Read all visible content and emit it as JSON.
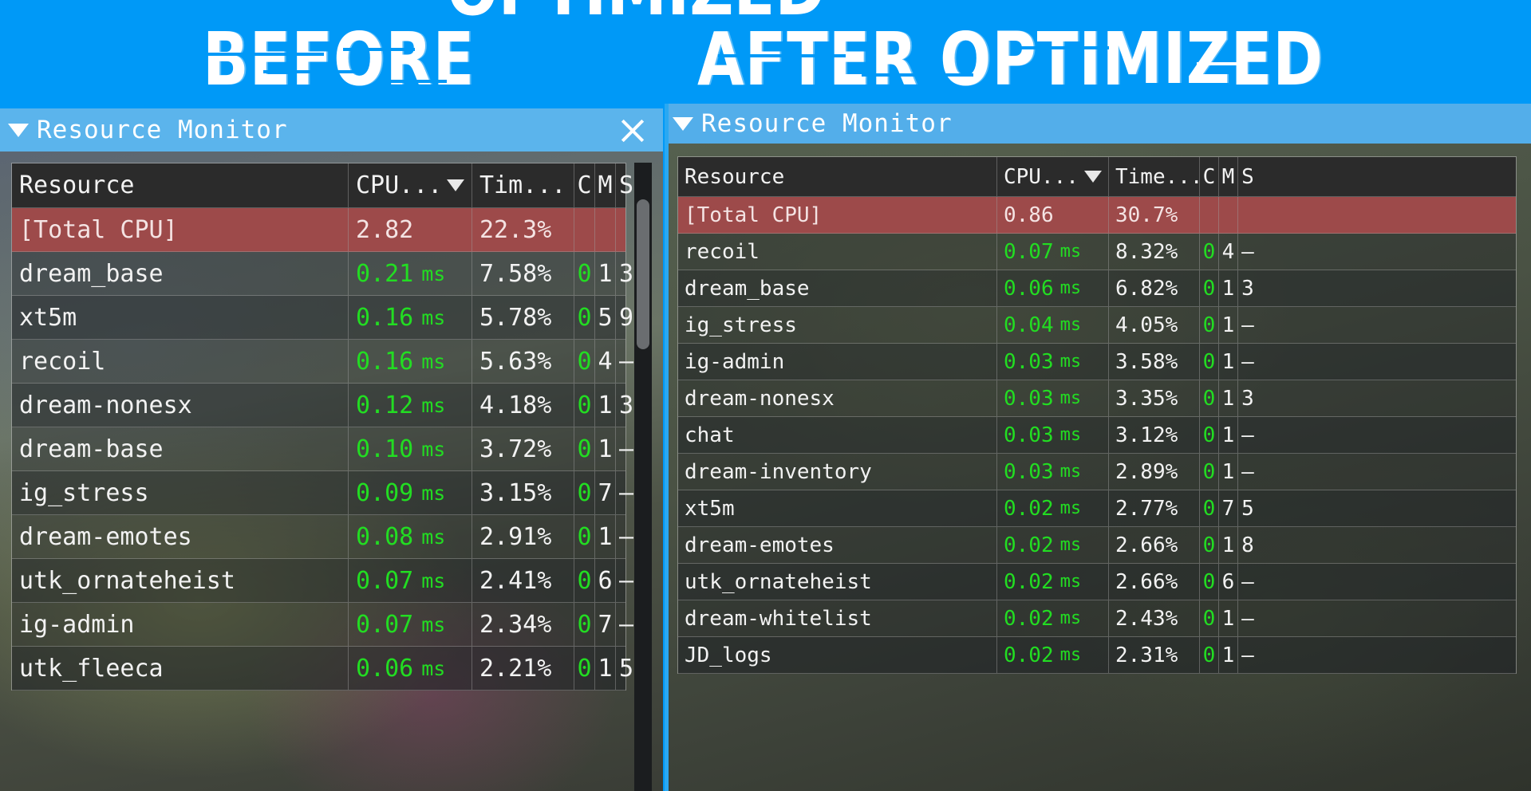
{
  "banner": {
    "before_label": "BEFORE",
    "after_label": "AFTER OPTIMIZED",
    "top_remnant": "OPTIMIZED",
    "background_color": "#0099f7"
  },
  "colors": {
    "banner_blue": "#0099f7",
    "titlebar_blue": "#5bb4ec",
    "total_row_red": "#9d4a4a",
    "value_green": "#22dd22",
    "header_dark": "#2b2b2b",
    "accent_outline": "#2aa8f2"
  },
  "left_window": {
    "title": "Resource Monitor",
    "collapse_icon": "triangle-down-icon",
    "close_icon": "close-icon",
    "columns": {
      "resource": "Resource",
      "cpu": "CPU...",
      "time": "Tim...",
      "c": "C",
      "m": "M",
      "s": "S"
    },
    "sort_indicator": "sort-descending-caret",
    "rows": [
      {
        "resource": "[Total CPU]",
        "cpu": "2.82",
        "unit": "",
        "time": "22.3%",
        "c": "",
        "m": "",
        "s": "",
        "total": true
      },
      {
        "resource": "dream_base",
        "cpu": "0.21",
        "unit": "ms",
        "time": "7.58%",
        "c": "0",
        "m": "1",
        "s": "3"
      },
      {
        "resource": "xt5m",
        "cpu": "0.16",
        "unit": "ms",
        "time": "5.78%",
        "c": "0",
        "m": "5",
        "s": "9"
      },
      {
        "resource": "recoil",
        "cpu": "0.16",
        "unit": "ms",
        "time": "5.63%",
        "c": "0",
        "m": "4",
        "s": "–"
      },
      {
        "resource": "dream-nonesx",
        "cpu": "0.12",
        "unit": "ms",
        "time": "4.18%",
        "c": "0",
        "m": "1",
        "s": "3"
      },
      {
        "resource": "dream-base",
        "cpu": "0.10",
        "unit": "ms",
        "time": "3.72%",
        "c": "0",
        "m": "1",
        "s": "–"
      },
      {
        "resource": "ig_stress",
        "cpu": "0.09",
        "unit": "ms",
        "time": "3.15%",
        "c": "0",
        "m": "7",
        "s": "–"
      },
      {
        "resource": "dream-emotes",
        "cpu": "0.08",
        "unit": "ms",
        "time": "2.91%",
        "c": "0",
        "m": "1",
        "s": "–"
      },
      {
        "resource": "utk_ornateheist",
        "cpu": "0.07",
        "unit": "ms",
        "time": "2.41%",
        "c": "0",
        "m": "6",
        "s": "–"
      },
      {
        "resource": "ig-admin",
        "cpu": "0.07",
        "unit": "ms",
        "time": "2.34%",
        "c": "0",
        "m": "7",
        "s": "–"
      },
      {
        "resource": "utk_fleeca",
        "cpu": "0.06",
        "unit": "ms",
        "time": "2.21%",
        "c": "0",
        "m": "1",
        "s": "5"
      }
    ]
  },
  "right_window": {
    "title": "Resource Monitor",
    "collapse_icon": "triangle-down-icon",
    "columns": {
      "resource": "Resource",
      "cpu": "CPU...",
      "time": "Time...",
      "c": "C",
      "m": "M",
      "s": "S"
    },
    "sort_indicator": "sort-descending-caret",
    "rows": [
      {
        "resource": "[Total CPU]",
        "cpu": "0.86",
        "unit": "",
        "time": "30.7%",
        "c": "",
        "m": "",
        "s": "",
        "total": true
      },
      {
        "resource": "recoil",
        "cpu": "0.07",
        "unit": "ms",
        "time": "8.32%",
        "c": "0",
        "m": "4",
        "s": "–"
      },
      {
        "resource": "dream_base",
        "cpu": "0.06",
        "unit": "ms",
        "time": "6.82%",
        "c": "0",
        "m": "1",
        "s": "3"
      },
      {
        "resource": "ig_stress",
        "cpu": "0.04",
        "unit": "ms",
        "time": "4.05%",
        "c": "0",
        "m": "1",
        "s": "–"
      },
      {
        "resource": "ig-admin",
        "cpu": "0.03",
        "unit": "ms",
        "time": "3.58%",
        "c": "0",
        "m": "1",
        "s": "–"
      },
      {
        "resource": "dream-nonesx",
        "cpu": "0.03",
        "unit": "ms",
        "time": "3.35%",
        "c": "0",
        "m": "1",
        "s": "3"
      },
      {
        "resource": "chat",
        "cpu": "0.03",
        "unit": "ms",
        "time": "3.12%",
        "c": "0",
        "m": "1",
        "s": "–"
      },
      {
        "resource": "dream-inventory",
        "cpu": "0.03",
        "unit": "ms",
        "time": "2.89%",
        "c": "0",
        "m": "1",
        "s": "–"
      },
      {
        "resource": "xt5m",
        "cpu": "0.02",
        "unit": "ms",
        "time": "2.77%",
        "c": "0",
        "m": "7",
        "s": "5"
      },
      {
        "resource": "dream-emotes",
        "cpu": "0.02",
        "unit": "ms",
        "time": "2.66%",
        "c": "0",
        "m": "1",
        "s": "8"
      },
      {
        "resource": "utk_ornateheist",
        "cpu": "0.02",
        "unit": "ms",
        "time": "2.66%",
        "c": "0",
        "m": "6",
        "s": "–"
      },
      {
        "resource": "dream-whitelist",
        "cpu": "0.02",
        "unit": "ms",
        "time": "2.43%",
        "c": "0",
        "m": "1",
        "s": "–"
      },
      {
        "resource": "JD_logs",
        "cpu": "0.02",
        "unit": "ms",
        "time": "2.31%",
        "c": "0",
        "m": "1",
        "s": "–"
      }
    ]
  }
}
